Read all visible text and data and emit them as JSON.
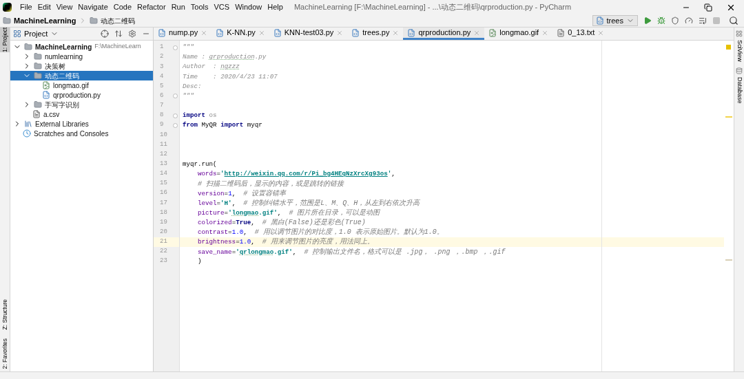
{
  "title_bar": {
    "menu": [
      "File",
      "Edit",
      "View",
      "Navigate",
      "Code",
      "Refactor",
      "Run",
      "Tools",
      "VCS",
      "Window",
      "Help"
    ],
    "title": "MachineLearning [F:\\MachineLearning] - ...\\动态二维码\\qrproduction.py - PyCharm"
  },
  "breadcrumbs": [
    "MachineLearning",
    "动态二维码"
  ],
  "run_config": {
    "label": "trees"
  },
  "left_tool_tabs": {
    "top": [
      {
        "label": "1: Project",
        "selected": true
      }
    ],
    "bottom": [
      {
        "label": "Z: Structure",
        "selected": false
      },
      {
        "label": "2: Favorites",
        "selected": false
      }
    ]
  },
  "right_tool_tabs": [
    {
      "label": "SciView"
    },
    {
      "label": "Database"
    }
  ],
  "project_panel": {
    "title": "Project",
    "tree": [
      {
        "kind": "module",
        "label": "MachineLearning",
        "path": "F:\\MachineLearn",
        "expanded": true,
        "selected": false,
        "children": [
          {
            "kind": "folder",
            "label": "numlearning",
            "expanded": false,
            "selected": false
          },
          {
            "kind": "folder",
            "label": "决策树",
            "expanded": false,
            "selected": false
          },
          {
            "kind": "folder",
            "label": "动态二维码",
            "expanded": true,
            "selected": true,
            "children": [
              {
                "kind": "gif",
                "label": "longmao.gif",
                "selected": false
              },
              {
                "kind": "py",
                "label": "qrproduction.py",
                "selected": false
              }
            ]
          },
          {
            "kind": "folder",
            "label": "手写字识别",
            "expanded": false,
            "selected": false
          },
          {
            "kind": "csv",
            "label": "a.csv",
            "selected": false
          }
        ]
      },
      {
        "kind": "libraries",
        "label": "External Libraries",
        "expanded": false,
        "selected": false
      },
      {
        "kind": "scratches",
        "label": "Scratches and Consoles",
        "selected": false
      }
    ]
  },
  "editor_tabs": [
    {
      "kind": "py",
      "label": "nump.py",
      "selected": false
    },
    {
      "kind": "py",
      "label": "K-NN.py",
      "selected": false
    },
    {
      "kind": "py",
      "label": "KNN-test03.py",
      "selected": false
    },
    {
      "kind": "py",
      "label": "trees.py",
      "selected": false
    },
    {
      "kind": "py",
      "label": "qrproduction.py",
      "selected": true
    },
    {
      "kind": "gif",
      "label": "longmao.gif",
      "selected": false
    },
    {
      "kind": "txt",
      "label": "0_13.txt",
      "selected": false
    }
  ],
  "code_lines": [
    {
      "number": "1",
      "fold": true,
      "current": false,
      "indented": false,
      "tokens": [
        {
          "kind": "doc",
          "text": "\"\"\""
        }
      ]
    },
    {
      "number": "2",
      "fold": false,
      "current": false,
      "indented": false,
      "tokens": [
        {
          "kind": "doc",
          "text": "Name : "
        },
        {
          "kind": "doc_typo",
          "text": "qrproduction"
        },
        {
          "kind": "doc",
          "text": ".py"
        }
      ]
    },
    {
      "number": "3",
      "fold": false,
      "current": false,
      "indented": false,
      "tokens": [
        {
          "kind": "doc",
          "text": "Author  : "
        },
        {
          "kind": "doc_typo",
          "text": "ngzzz"
        }
      ]
    },
    {
      "number": "4",
      "fold": false,
      "current": false,
      "indented": false,
      "tokens": [
        {
          "kind": "doc",
          "text": "Time    : 2020/4/23 11:07"
        }
      ]
    },
    {
      "number": "5",
      "fold": false,
      "current": false,
      "indented": false,
      "tokens": [
        {
          "kind": "doc",
          "text": "Desc:"
        }
      ]
    },
    {
      "number": "6",
      "fold": true,
      "current": false,
      "indented": false,
      "tokens": [
        {
          "kind": "doc",
          "text": "\"\"\""
        }
      ]
    },
    {
      "number": "7",
      "fold": false,
      "current": false
    },
    {
      "number": "8",
      "fold": true,
      "current": false,
      "indented": false,
      "tokens": [
        {
          "kind": "keyword",
          "text": "import"
        },
        {
          "kind": "unused",
          "text": " os"
        }
      ]
    },
    {
      "number": "9",
      "fold": true,
      "current": false,
      "indented": false,
      "tokens": [
        {
          "kind": "keyword",
          "text": "from"
        },
        {
          "kind": "plain",
          "text": " MyQR "
        },
        {
          "kind": "keyword",
          "text": "import"
        },
        {
          "kind": "plain",
          "text": " myqr"
        }
      ]
    },
    {
      "number": "10",
      "fold": false,
      "current": false
    },
    {
      "number": "11",
      "fold": false,
      "current": false
    },
    {
      "number": "12",
      "fold": false,
      "current": false
    },
    {
      "number": "13",
      "fold": false,
      "current": false,
      "indented": false,
      "tokens": [
        {
          "kind": "plain",
          "text": "myqr.run("
        }
      ]
    },
    {
      "number": "14",
      "fold": false,
      "current": false,
      "indented": true,
      "tokens": [
        {
          "kind": "param",
          "text": "words"
        },
        {
          "kind": "plain",
          "text": "="
        },
        {
          "kind": "string",
          "text": "'"
        },
        {
          "kind": "url",
          "text": "http://weixin.qq.com/r/Pi_bg4HEqNzXrcXg93os"
        },
        {
          "kind": "string",
          "text": "'"
        },
        {
          "kind": "plain",
          "text": ","
        }
      ]
    },
    {
      "number": "15",
      "fold": false,
      "current": false,
      "indented": true,
      "tokens": [
        {
          "kind": "comment",
          "text": "# 扫描二维码后，显示的内容，或是跳转的链接"
        }
      ]
    },
    {
      "number": "16",
      "fold": false,
      "current": false,
      "indented": true,
      "tokens": [
        {
          "kind": "param",
          "text": "version"
        },
        {
          "kind": "plain",
          "text": "="
        },
        {
          "kind": "number",
          "text": "1"
        },
        {
          "kind": "plain",
          "text": ",  "
        },
        {
          "kind": "comment",
          "text": "# 设置容错率"
        }
      ]
    },
    {
      "number": "17",
      "fold": false,
      "current": false,
      "indented": true,
      "tokens": [
        {
          "kind": "param",
          "text": "level"
        },
        {
          "kind": "plain",
          "text": "="
        },
        {
          "kind": "string",
          "text": "'H'"
        },
        {
          "kind": "plain",
          "text": ",  "
        },
        {
          "kind": "comment",
          "text": "# 控制纠错水平，范围是L、M、Q、H，从左到右依次升高"
        }
      ]
    },
    {
      "number": "18",
      "fold": false,
      "current": false,
      "indented": true,
      "tokens": [
        {
          "kind": "param",
          "text": "picture"
        },
        {
          "kind": "plain",
          "text": "="
        },
        {
          "kind": "string",
          "text": "'"
        },
        {
          "kind": "string_typo",
          "text": "longmao"
        },
        {
          "kind": "string",
          "text": ".gif'"
        },
        {
          "kind": "plain",
          "text": ",  "
        },
        {
          "kind": "comment",
          "text": "# 图片所在目录，可以是动图"
        }
      ]
    },
    {
      "number": "19",
      "fold": false,
      "current": false,
      "indented": true,
      "tokens": [
        {
          "kind": "param",
          "text": "colorized"
        },
        {
          "kind": "plain",
          "text": "="
        },
        {
          "kind": "keyword",
          "text": "True"
        },
        {
          "kind": "plain",
          "text": ",  "
        },
        {
          "kind": "comment",
          "text": "# 黑白(False)还是彩色(True)"
        }
      ]
    },
    {
      "number": "20",
      "fold": false,
      "current": false,
      "indented": true,
      "tokens": [
        {
          "kind": "param",
          "text": "contrast"
        },
        {
          "kind": "plain",
          "text": "="
        },
        {
          "kind": "number",
          "text": "1.0"
        },
        {
          "kind": "plain",
          "text": ",  "
        },
        {
          "kind": "comment",
          "text": "# 用以调节图片的对比度，1.0 表示原始图片。默认为1.0。"
        }
      ]
    },
    {
      "number": "21",
      "fold": false,
      "current": true,
      "indented": true,
      "tokens": [
        {
          "kind": "param",
          "text": "brightness"
        },
        {
          "kind": "plain",
          "text": "="
        },
        {
          "kind": "number",
          "text": "1.0"
        },
        {
          "kind": "plain",
          "text": ",  "
        },
        {
          "kind": "comment",
          "text": "# 用来调节图片的亮度，用法同上。"
        }
      ]
    },
    {
      "number": "22",
      "fold": false,
      "current": false,
      "indented": true,
      "tokens": [
        {
          "kind": "param",
          "text": "save_name"
        },
        {
          "kind": "plain",
          "text": "="
        },
        {
          "kind": "string",
          "text": "'"
        },
        {
          "kind": "string_typo",
          "text": "qrlongmao"
        },
        {
          "kind": "string",
          "text": ".gif'"
        },
        {
          "kind": "plain",
          "text": ",  "
        },
        {
          "kind": "comment",
          "text": "# 控制输出文件名，格式可以是 .jpg， .png ，.bmp ，.gif"
        }
      ]
    },
    {
      "number": "23",
      "fold": false,
      "current": false,
      "indented": true,
      "tokens": [
        {
          "kind": "plain",
          "text": ")"
        }
      ]
    }
  ]
}
